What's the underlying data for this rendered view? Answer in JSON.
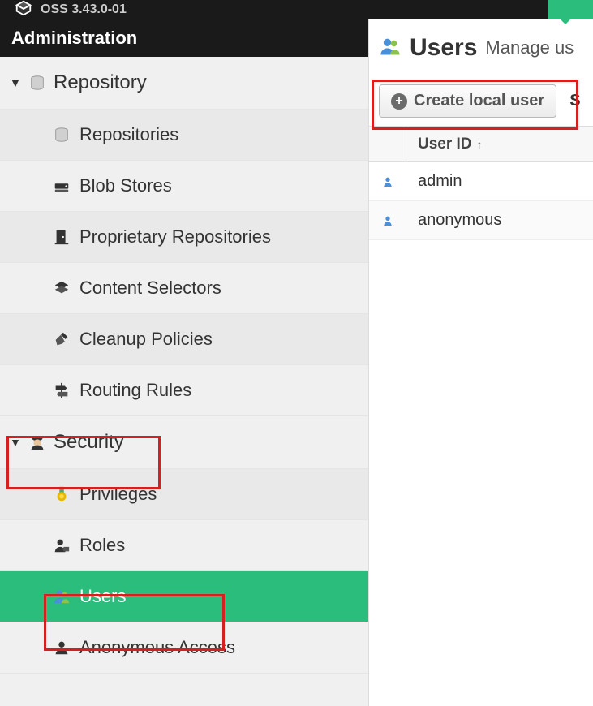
{
  "topbar": {
    "version": "OSS 3.43.0-01"
  },
  "sidebar": {
    "title": "Administration",
    "groups": [
      {
        "label": "Repository",
        "items": [
          {
            "label": "Repositories"
          },
          {
            "label": "Blob Stores"
          },
          {
            "label": "Proprietary Repositories"
          },
          {
            "label": "Content Selectors"
          },
          {
            "label": "Cleanup Policies"
          },
          {
            "label": "Routing Rules"
          }
        ]
      },
      {
        "label": "Security",
        "items": [
          {
            "label": "Privileges"
          },
          {
            "label": "Roles"
          },
          {
            "label": "Users"
          },
          {
            "label": "Anonymous Access"
          }
        ]
      }
    ]
  },
  "main": {
    "title": "Users",
    "subtitle": "Manage us",
    "create_button": "Create local user",
    "toolbar_extra": "S",
    "table": {
      "column_header": "User ID",
      "rows": [
        {
          "id": "admin"
        },
        {
          "id": "anonymous"
        }
      ]
    }
  }
}
